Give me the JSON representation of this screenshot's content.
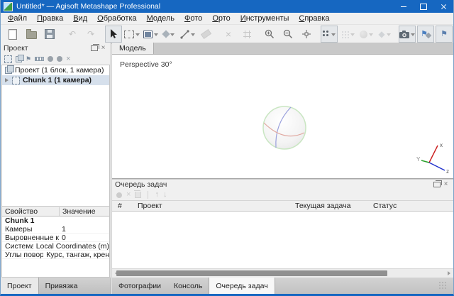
{
  "window": {
    "title": "Untitled* — Agisoft Metashape Professional"
  },
  "menu": {
    "items": [
      {
        "accel": "Ф",
        "rest": "айл"
      },
      {
        "accel": "П",
        "rest": "равка"
      },
      {
        "accel": "В",
        "rest": "ид"
      },
      {
        "accel": "О",
        "rest": "бработка"
      },
      {
        "accel": "М",
        "rest": "одель"
      },
      {
        "accel": "Ф",
        "rest": "ото"
      },
      {
        "accel": "О",
        "rest": "рто"
      },
      {
        "accel": "И",
        "rest": "нструменты"
      },
      {
        "accel": "С",
        "rest": "правка"
      }
    ]
  },
  "icons": {
    "undo": "↶",
    "redo": "↷",
    "delete": "×",
    "close": "×",
    "diamond": "◆",
    "flag": "⚑",
    "arrow_up": "↑",
    "arrow_down": "↓"
  },
  "workspace": {
    "title": "Проект",
    "tree": {
      "root": "Проект (1 блок, 1 камера)",
      "chunk": "Chunk 1 (1 камера)"
    },
    "properties": {
      "col_property": "Свойство",
      "col_value": "Значение",
      "group": "Chunk 1",
      "rows": [
        {
          "name": "Камеры",
          "value": "1"
        },
        {
          "name": "Выровненные камеры",
          "value": "0"
        },
        {
          "name": "Система координат",
          "value": "Local Coordinates (m)"
        },
        {
          "name": "Углы поворота",
          "value": "Курс, тангаж, крен"
        }
      ]
    },
    "tabs": [
      {
        "label": "Проект"
      },
      {
        "label": "Привязка"
      }
    ]
  },
  "model_view": {
    "tab": "Модель",
    "perspective": "Perspective 30°",
    "axes": {
      "x": "x",
      "y": "Y",
      "z": "z"
    }
  },
  "task_queue": {
    "title": "Очередь задач",
    "columns": {
      "num": "#",
      "project": "Проект",
      "current_task": "Текущая задача",
      "status": "Статус"
    }
  },
  "bottom_tabs": [
    {
      "label": "Фотографии"
    },
    {
      "label": "Консоль"
    },
    {
      "label": "Очередь задач"
    }
  ],
  "colors": {
    "titlebar": "#1667c1",
    "tree_selection": "#d6e0ec",
    "axis_x": "#cc2222",
    "axis_y": "#2aa02a",
    "axis_z": "#2233cc",
    "sphere_outline": "#c9e6c2",
    "sphere_meridian": "#9aa0dc",
    "sphere_equator": "#e0a8a0"
  }
}
